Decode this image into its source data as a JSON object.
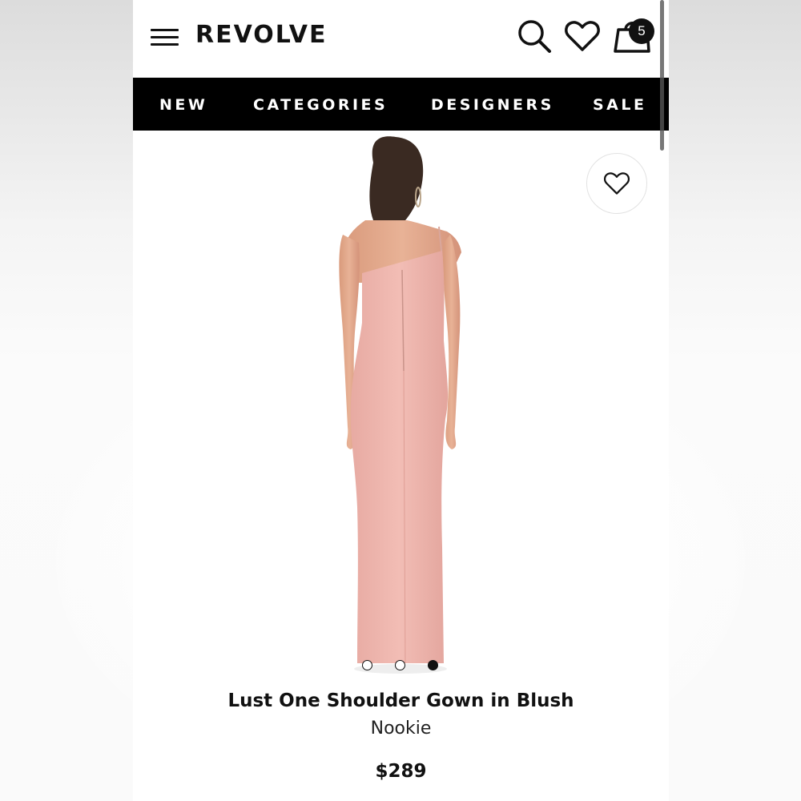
{
  "header": {
    "logo": "REVOLVE",
    "bag_count": "5",
    "icons": [
      "menu-icon",
      "search-icon",
      "heart-icon",
      "shopping-bag-icon"
    ]
  },
  "nav": {
    "items": [
      {
        "label": "NEW"
      },
      {
        "label": "CATEGORIES"
      },
      {
        "label": "DESIGNERS"
      },
      {
        "label": "SALE"
      }
    ]
  },
  "product": {
    "name": "Lust One Shoulder Gown in Blush",
    "brand": "Nookie",
    "price": "$289",
    "image_count": 3,
    "active_image_index": 3,
    "dress_color": "#f0b9b2"
  },
  "colors": {
    "nav_background": "#000000",
    "nav_text": "#ffffff",
    "accent": "#111111"
  }
}
